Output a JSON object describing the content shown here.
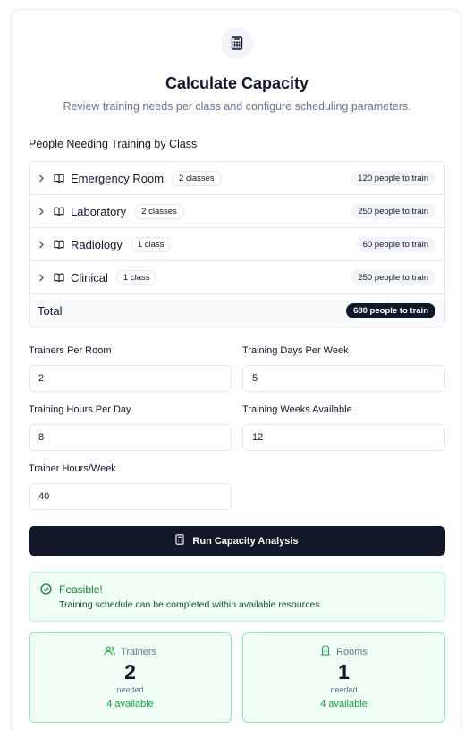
{
  "header": {
    "icon": "calculator-icon",
    "title": "Calculate Capacity",
    "subtitle": "Review training needs per class and configure scheduling parameters."
  },
  "classes_section": {
    "label": "People Needing Training by Class",
    "rows": [
      {
        "name": "Emergency Room",
        "classes": "2 classes",
        "people": "120 people to train"
      },
      {
        "name": "Laboratory",
        "classes": "2 classes",
        "people": "250 people to train"
      },
      {
        "name": "Radiology",
        "classes": "1 class",
        "people": "60 people to train"
      },
      {
        "name": "Clinical",
        "classes": "1 class",
        "people": "250 people to train"
      }
    ],
    "total": {
      "label": "Total",
      "people": "680 people to train"
    }
  },
  "params": {
    "trainers_per_room": {
      "label": "Trainers Per Room",
      "value": "2"
    },
    "training_days_per_week": {
      "label": "Training Days Per Week",
      "value": "5"
    },
    "training_hours_per_day": {
      "label": "Training Hours Per Day",
      "value": "8"
    },
    "training_weeks_available": {
      "label": "Training Weeks Available",
      "value": "12"
    },
    "trainer_hours_week": {
      "label": "Trainer Hours/Week",
      "value": "40"
    }
  },
  "run_button": {
    "label": "Run Capacity Analysis",
    "icon": "calculator-icon"
  },
  "result": {
    "title": "Feasible!",
    "message": "Training schedule can be completed within available resources.",
    "trainers": {
      "label": "Trainers",
      "value": "2",
      "needed": "needed",
      "available": "4 available",
      "icon": "users-icon"
    },
    "rooms": {
      "label": "Rooms",
      "value": "1",
      "needed": "needed",
      "available": "4 available",
      "icon": "building-icon"
    }
  },
  "colors": {
    "accent": "#111827",
    "success": "#16a34a",
    "success_bg": "#f0fdf4"
  }
}
